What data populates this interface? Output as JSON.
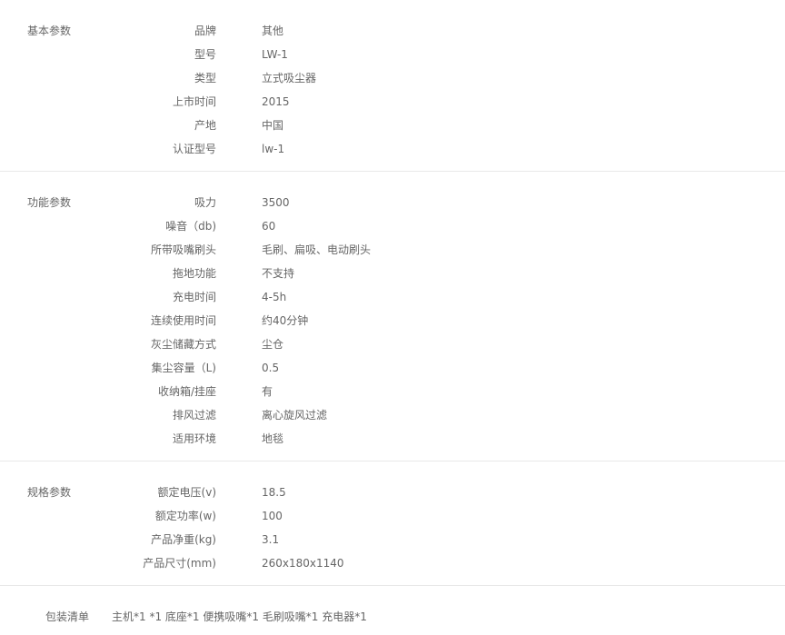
{
  "sections": [
    {
      "title": "基本参数",
      "rows": [
        {
          "key": "品牌",
          "val": "其他"
        },
        {
          "key": "型号",
          "val": "LW-1"
        },
        {
          "key": "类型",
          "val": "立式吸尘器"
        },
        {
          "key": "上市时间",
          "val": "2015"
        },
        {
          "key": "产地",
          "val": "中国"
        },
        {
          "key": "认证型号",
          "val": "lw-1"
        }
      ]
    },
    {
      "title": "功能参数",
      "rows": [
        {
          "key": "吸力",
          "val": "3500"
        },
        {
          "key": "噪音（db)",
          "val": "60"
        },
        {
          "key": "所带吸嘴刷头",
          "val": "毛刷、扁吸、电动刷头"
        },
        {
          "key": "拖地功能",
          "val": "不支持"
        },
        {
          "key": "充电时间",
          "val": "4-5h"
        },
        {
          "key": "连续使用时间",
          "val": "约40分钟"
        },
        {
          "key": "灰尘储藏方式",
          "val": "尘仓"
        },
        {
          "key": "集尘容量（L)",
          "val": "0.5"
        },
        {
          "key": "收纳箱/挂座",
          "val": "有"
        },
        {
          "key": "排风过滤",
          "val": "离心旋风过滤"
        },
        {
          "key": "适用环境",
          "val": "地毯"
        }
      ]
    },
    {
      "title": "规格参数",
      "rows": [
        {
          "key": "额定电压(v)",
          "val": "18.5"
        },
        {
          "key": "额定功率(w)",
          "val": "100"
        },
        {
          "key": "产品净重(kg)",
          "val": "3.1"
        },
        {
          "key": "产品尺寸(mm)",
          "val": "260x180x1140"
        }
      ]
    }
  ],
  "packing": {
    "label": "包装清单",
    "value": "主机*1 *1 底座*1 便携吸嘴*1 毛刷吸嘴*1 充电器*1"
  }
}
